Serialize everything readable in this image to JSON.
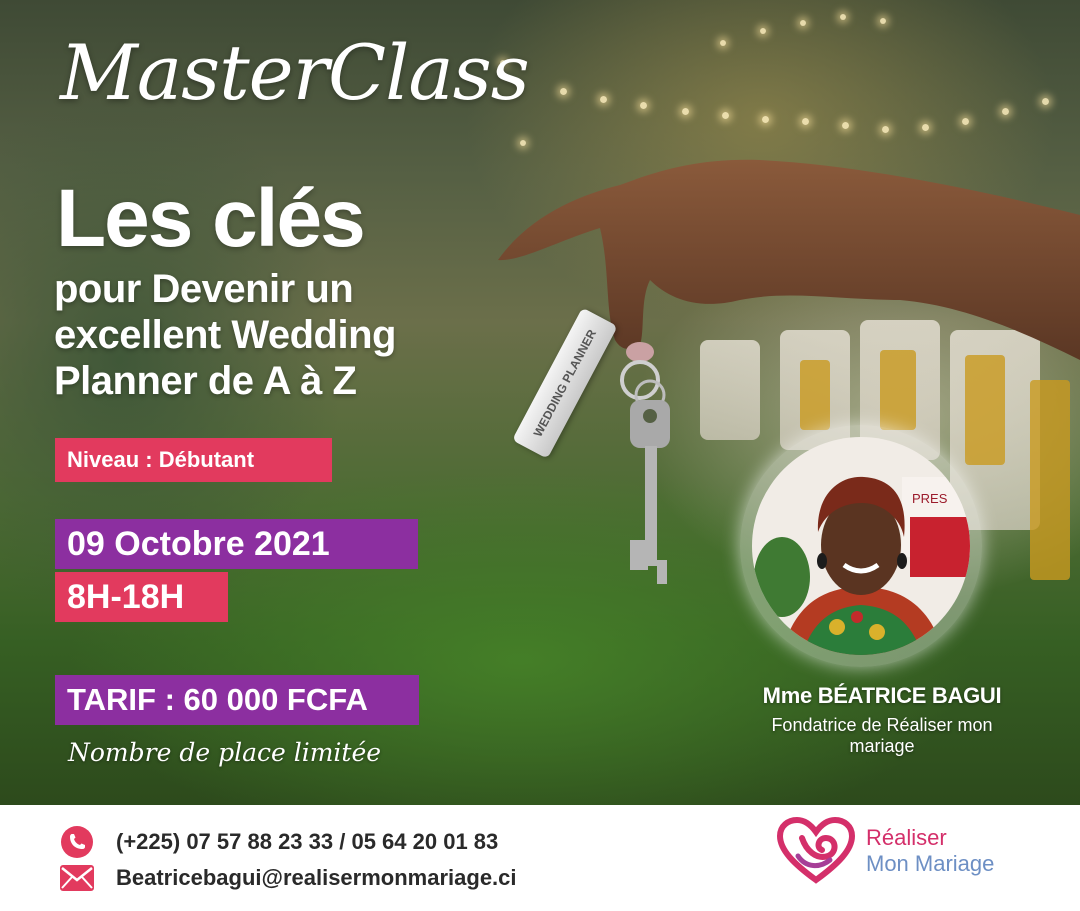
{
  "masterclass_title": "MasterClass",
  "headline": "Les clés",
  "subhead_lines": [
    "pour Devenir un",
    "excellent Wedding",
    "Planner de A à Z"
  ],
  "level": "Niveau : Débutant",
  "date": "09 Octobre 2021",
  "time": "8H-18H",
  "price": "TARIF : 60 000 FCFA",
  "places_note": "Nombre de place limitée",
  "keychain_label": "WEDDING PLANNER",
  "portrait_sign_text": "PRES",
  "speaker": {
    "name": "Mme BÉATRICE BAGUI",
    "role": "Fondatrice de Réaliser mon mariage"
  },
  "contact": {
    "phone": "(+225) 07 57 88 23 33 / 05 64 20 01 83",
    "email": "Beatricebagui@realisermonmariage.ci",
    "phone_icon": "phone-icon",
    "email_icon": "envelope-icon"
  },
  "brand": {
    "line1": "Réaliser",
    "line2": "Mon Mariage"
  },
  "colors": {
    "pink": "#e23a5e",
    "purple": "#8c2fa0",
    "brand_pink": "#d42f6a",
    "brand_blue": "#6d8fc4"
  }
}
